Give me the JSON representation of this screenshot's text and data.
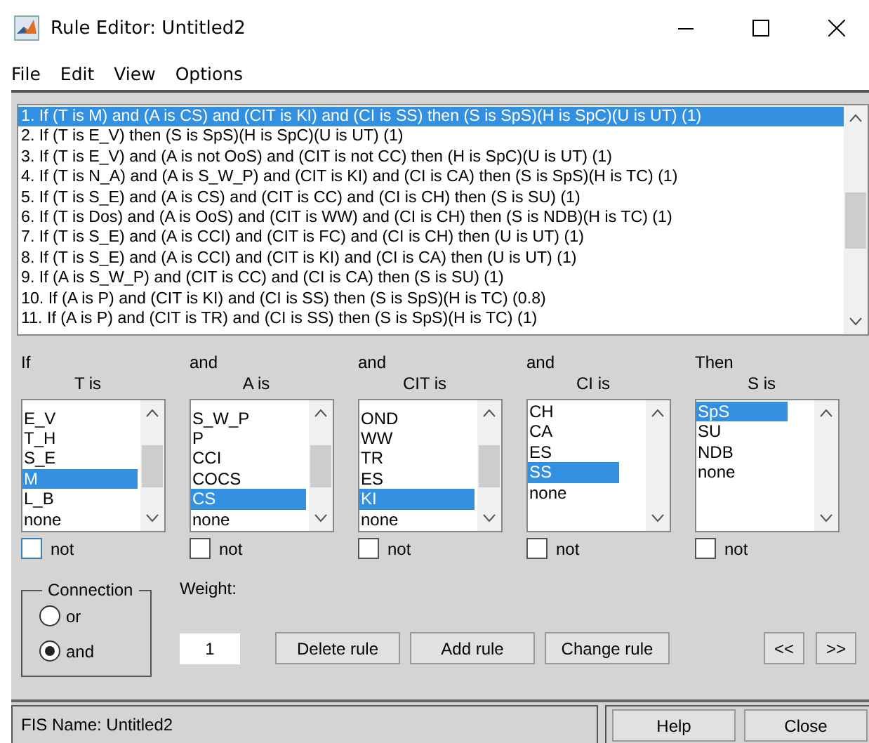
{
  "window": {
    "title": "Rule Editor: Untitled2"
  },
  "menu": [
    "File",
    "Edit",
    "View",
    "Options"
  ],
  "rules": [
    {
      "text": "1. If (T is M) and (A is CS) and (CIT is KI) and (CI is SS) then (S is SpS)(H is SpC)(U is UT) (1)",
      "selected": true
    },
    {
      "text": "2. If (T is E_V) then (S is SpS)(H is SpC)(U is UT) (1)",
      "selected": false
    },
    {
      "text": "3. If (T is E_V) and (A is not OoS) and (CIT is not CC) then (H is SpC)(U is UT) (1)",
      "selected": false
    },
    {
      "text": "4. If (T is N_A) and (A is S_W_P) and (CIT is KI) and (CI is CA) then (S is SpS)(H is TC) (1)",
      "selected": false
    },
    {
      "text": "5. If (T is S_E) and (A is CS) and (CIT is CC) and (CI is CH) then (S is SU) (1)",
      "selected": false
    },
    {
      "text": "6. If (T is Dos) and (A is OoS) and (CIT is WW) and (CI is CH) then (S is NDB)(H is TC) (1)",
      "selected": false
    },
    {
      "text": "7. If (T is S_E) and (A is CCI) and (CIT is FC) and (CI is CH) then (U is UT) (1)",
      "selected": false
    },
    {
      "text": "8. If (T is S_E) and (A is CCI) and (CIT is KI) and (CI is CA) then (U is UT) (1)",
      "selected": false
    },
    {
      "text": "9. If (A is S_W_P) and (CIT is CC) and (CI is CA) then (S is SU) (1)",
      "selected": false
    },
    {
      "text": "10. If (A is P) and (CIT is KI) and (CI is SS) then (S is SpS)(H is TC) (0.8)",
      "selected": false
    },
    {
      "text": "11. If (A is P) and (CIT is TR) and (CI is SS) then (S is SpS)(H is TC) (1)",
      "selected": false
    }
  ],
  "columns": [
    {
      "connector": "If",
      "title": "T is",
      "scrollable": true,
      "not_checked": false,
      "not_label": "not",
      "items": [
        {
          "label": "E_V",
          "selected": false
        },
        {
          "label": "T_H",
          "selected": false
        },
        {
          "label": "S_E",
          "selected": false
        },
        {
          "label": "M",
          "selected": true
        },
        {
          "label": "L_B",
          "selected": false
        },
        {
          "label": "none",
          "selected": false
        }
      ]
    },
    {
      "connector": "and",
      "title": "A is",
      "scrollable": true,
      "not_checked": false,
      "not_label": "not",
      "items": [
        {
          "label": "S_W_P",
          "selected": false
        },
        {
          "label": "P",
          "selected": false
        },
        {
          "label": "CCI",
          "selected": false
        },
        {
          "label": "COCS",
          "selected": false
        },
        {
          "label": "CS",
          "selected": true
        },
        {
          "label": "none",
          "selected": false
        }
      ]
    },
    {
      "connector": "and",
      "title": "CIT is",
      "scrollable": true,
      "not_checked": false,
      "not_label": "not",
      "items": [
        {
          "label": "OND",
          "selected": false
        },
        {
          "label": "WW",
          "selected": false
        },
        {
          "label": "TR",
          "selected": false
        },
        {
          "label": "ES",
          "selected": false
        },
        {
          "label": "KI",
          "selected": true
        },
        {
          "label": "none",
          "selected": false
        }
      ]
    },
    {
      "connector": "and",
      "title": "CI is",
      "scrollable": false,
      "not_checked": false,
      "not_label": "not",
      "items": [
        {
          "label": "CH",
          "selected": false
        },
        {
          "label": "CA",
          "selected": false
        },
        {
          "label": "ES",
          "selected": false
        },
        {
          "label": "SS",
          "selected": true
        },
        {
          "label": "none",
          "selected": false
        }
      ]
    },
    {
      "connector": "Then",
      "title": "S is",
      "scrollable": false,
      "not_checked": false,
      "not_label": "not",
      "items": [
        {
          "label": "SpS",
          "selected": true
        },
        {
          "label": "SU",
          "selected": false
        },
        {
          "label": "NDB",
          "selected": false
        },
        {
          "label": "none",
          "selected": false
        }
      ]
    }
  ],
  "connection": {
    "title": "Connection",
    "options": [
      {
        "label": "or",
        "selected": false
      },
      {
        "label": "and",
        "selected": true
      }
    ]
  },
  "weight": {
    "label": "Weight:",
    "value": "1"
  },
  "buttons": [
    "Delete rule",
    "Add rule",
    "Change rule"
  ],
  "nav_buttons": [
    "<<",
    ">>"
  ],
  "status": "FIS Name: Untitled2",
  "footer_buttons": [
    "Help",
    "Close"
  ]
}
